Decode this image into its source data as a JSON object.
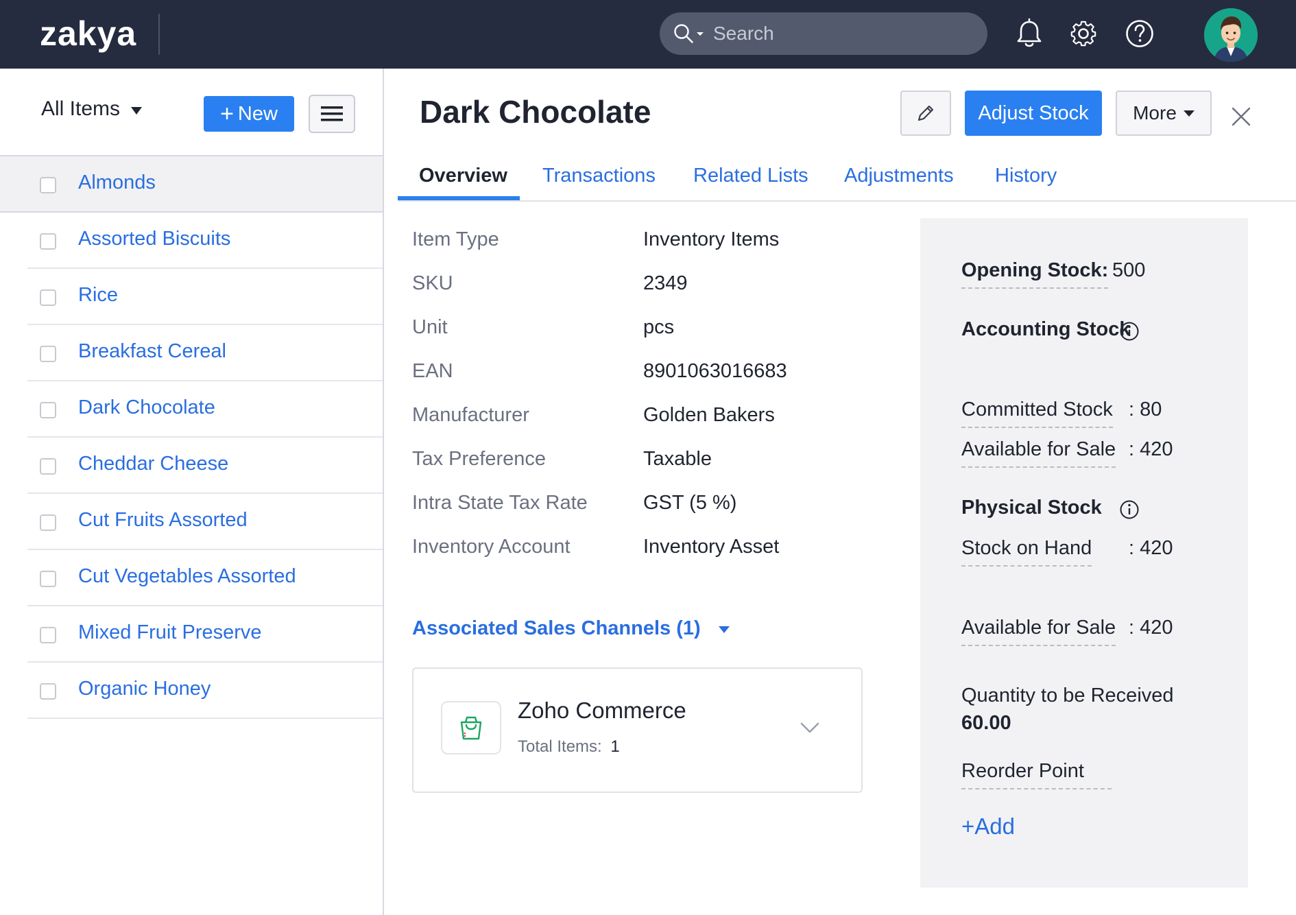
{
  "app": {
    "logo": "zakya"
  },
  "search": {
    "placeholder": "Search"
  },
  "sidebar": {
    "filter_label": "All Items",
    "new_button": "New",
    "items": [
      {
        "label": "Almonds"
      },
      {
        "label": "Assorted Biscuits"
      },
      {
        "label": "Rice"
      },
      {
        "label": "Breakfast Cereal"
      },
      {
        "label": "Dark Chocolate"
      },
      {
        "label": "Cheddar Cheese"
      },
      {
        "label": "Cut Fruits Assorted"
      },
      {
        "label": "Cut Vegetables Assorted"
      },
      {
        "label": "Mixed Fruit Preserve"
      },
      {
        "label": "Organic Honey"
      }
    ]
  },
  "detail": {
    "title": "Dark Chocolate",
    "adjust_stock_label": "Adjust Stock",
    "more_label": "More",
    "tabs": [
      {
        "label": "Overview",
        "active": true
      },
      {
        "label": "Transactions"
      },
      {
        "label": "Related Lists"
      },
      {
        "label": "Adjustments"
      },
      {
        "label": "History"
      }
    ],
    "fields": [
      {
        "label": "Item Type",
        "value": "Inventory Items"
      },
      {
        "label": "SKU",
        "value": "2349"
      },
      {
        "label": "Unit",
        "value": "pcs"
      },
      {
        "label": "EAN",
        "value": "8901063016683"
      },
      {
        "label": "Manufacturer",
        "value": "Golden Bakers"
      },
      {
        "label": "Tax Preference",
        "value": "Taxable"
      },
      {
        "label": "Intra State Tax Rate",
        "value": "GST (5 %)"
      },
      {
        "label": "Inventory Account",
        "value": "Inventory Asset"
      }
    ],
    "associated_channels_label": "Associated Sales Channels (1)",
    "channel": {
      "name": "Zoho Commerce",
      "total_label": "Total Items:",
      "total_value": "1"
    }
  },
  "stock": {
    "opening_label": "Opening Stock:",
    "opening_value": "500",
    "accounting_label": "Accounting Stock",
    "committed_label": "Committed Stock",
    "committed_value": ": 80",
    "available_label": "Available for Sale",
    "available_value": ": 420",
    "physical_label": "Physical Stock",
    "on_hand_label": "Stock on Hand",
    "on_hand_value": ": 420",
    "physical_available_label": "Available for Sale",
    "physical_available_value": ": 420",
    "to_receive_label": "Quantity to be Received",
    "to_receive_value": "60.00",
    "reorder_label": "Reorder Point",
    "add_label": "+Add"
  },
  "colors": {
    "topbar": "#262c3f",
    "accent": "#2a80f0",
    "link": "#2a6ee0",
    "avatar_bg": "#17a58a",
    "channel_icon": "#1aa663"
  }
}
